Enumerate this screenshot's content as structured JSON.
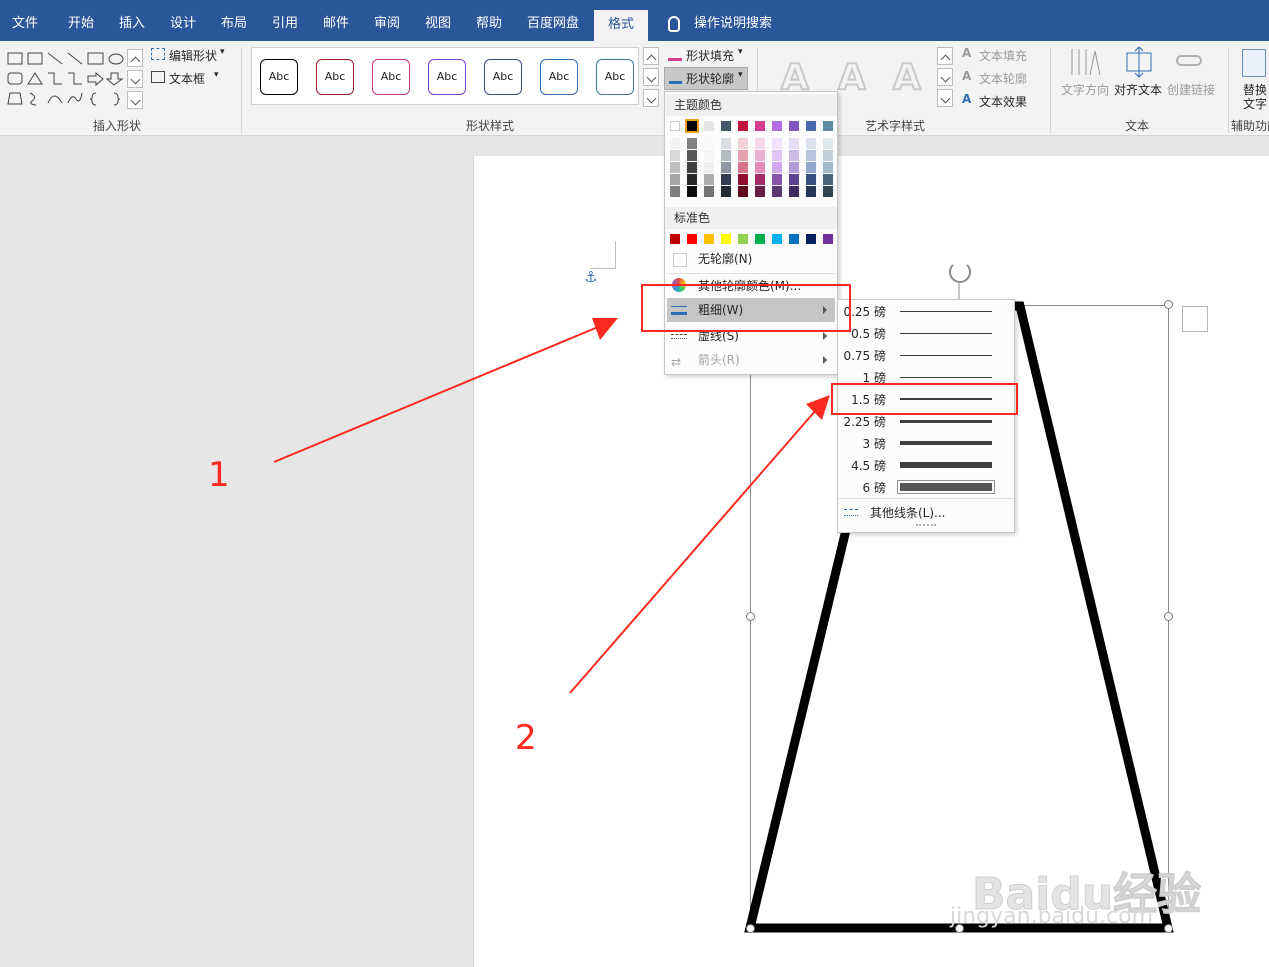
{
  "tabs": [
    "文件",
    "开始",
    "插入",
    "设计",
    "布局",
    "引用",
    "邮件",
    "审阅",
    "视图",
    "帮助",
    "百度网盘",
    "格式",
    "操作说明搜索"
  ],
  "ribbon": {
    "insert_shapes": {
      "edit_shape": "编辑形状",
      "text_box": "文本框",
      "label": "插入形状"
    },
    "shape_styles": {
      "sample": "Abc",
      "label": "形状样式",
      "border_colors": [
        "#000000",
        "#9b1b30",
        "#c0367f",
        "#7e3fc8",
        "#3d4a8c",
        "#2f6db5",
        "#3b7ea1"
      ]
    },
    "shape_fill": "形状填充",
    "shape_outline": "形状轮廓",
    "wordart": {
      "letter": "A",
      "label": "艺术字样式",
      "text_fill": "文本填充",
      "text_outline": "文本轮廓",
      "text_effects": "文本效果"
    },
    "text": {
      "direction": "文字方向",
      "align": "对齐文本",
      "link": "创建链接",
      "label": "文本"
    },
    "accessibility": {
      "alt_text_1": "替换",
      "alt_text_2": "文字",
      "label": "辅助功能"
    }
  },
  "outline_menu": {
    "theme_colors_title": "主题颜色",
    "theme_colors": [
      "#ffffff",
      "#000000",
      "#e7e6e6",
      "#44546a",
      "#c0143c",
      "#d63d8c",
      "#b46de4",
      "#7e57c2",
      "#4a6bab",
      "#5f8aa3"
    ],
    "standard_colors_title": "标准色",
    "standard_colors": [
      "#c00000",
      "#ff0000",
      "#ffc000",
      "#ffff00",
      "#92d050",
      "#00b050",
      "#00b0f0",
      "#0070c0",
      "#002060",
      "#7030a0"
    ],
    "no_outline": "无轮廓(N)",
    "more_colors": "其他轮廓颜色(M)...",
    "weight": "粗细(W)",
    "dashes": "虚线(S)",
    "arrows": "箭头(R)"
  },
  "weight_menu": {
    "items": [
      {
        "label": "0.25 磅",
        "pt": 0.25
      },
      {
        "label": "0.5 磅",
        "pt": 0.5
      },
      {
        "label": "0.75 磅",
        "pt": 0.75
      },
      {
        "label": "1 磅",
        "pt": 1
      },
      {
        "label": "1.5 磅",
        "pt": 1.5
      },
      {
        "label": "2.25 磅",
        "pt": 2.25
      },
      {
        "label": "3 磅",
        "pt": 3
      },
      {
        "label": "4.5 磅",
        "pt": 4.5
      },
      {
        "label": "6 磅",
        "pt": 6
      }
    ],
    "more_lines": "其他线条(L)..."
  },
  "annotations": {
    "step1": "1",
    "step2": "2",
    "color": "#ff2a1f"
  },
  "watermark": {
    "brand": "Baidu经验",
    "url": "jingyan.baidu.com"
  }
}
